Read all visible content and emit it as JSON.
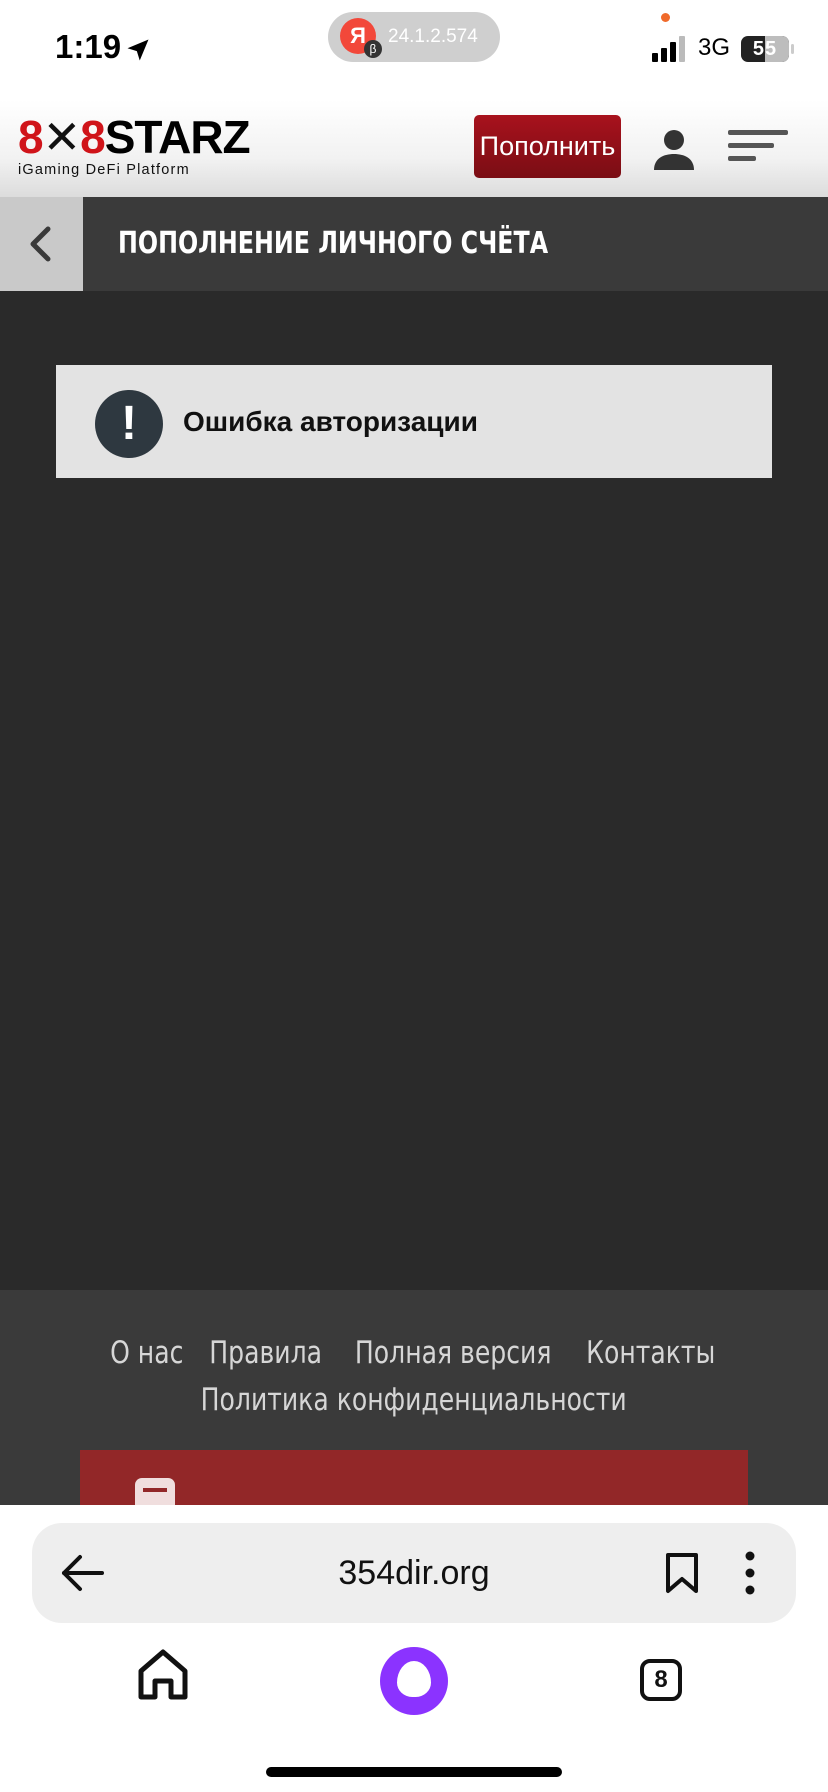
{
  "status_bar": {
    "time": "1:19",
    "browser_pill": {
      "logo_letter": "Я",
      "beta_mark": "β",
      "version": "24.1.2.574"
    },
    "network": "3G",
    "battery": "55"
  },
  "header": {
    "logo": {
      "eights": "8",
      "star": "✕",
      "word": "STARZ",
      "tagline": "iGaming DeFi Platform"
    },
    "deposit_label": "Пополнить",
    "icons": {
      "user": "user-icon",
      "menu": "hamburger-menu-icon"
    }
  },
  "page_bar": {
    "title": "ПОПОЛНЕНИЕ ЛИЧНОГО СЧЁТА",
    "back_icon": "chevron-left-icon"
  },
  "error": {
    "icon_symbol": "!",
    "message": "Ошибка авторизации"
  },
  "footer": {
    "links": [
      "О нас",
      "Правила",
      "Полная версия",
      "Контакты",
      "Политика конфиденциальности"
    ]
  },
  "browser": {
    "url": "354dir.org",
    "tabs_count": "8",
    "icons": {
      "back": "arrow-left-icon",
      "bookmark": "bookmark-icon",
      "more": "more-vertical-icon",
      "home": "home-icon",
      "alice": "alice-assistant-icon",
      "tabs": "tabs-icon"
    }
  },
  "colors": {
    "brand_red": "#a8121d",
    "page_background": "#2a2a2a",
    "bar_background": "#3a3a3a",
    "footer_banner": "#922728",
    "alice_purple": "#8b33ff"
  }
}
